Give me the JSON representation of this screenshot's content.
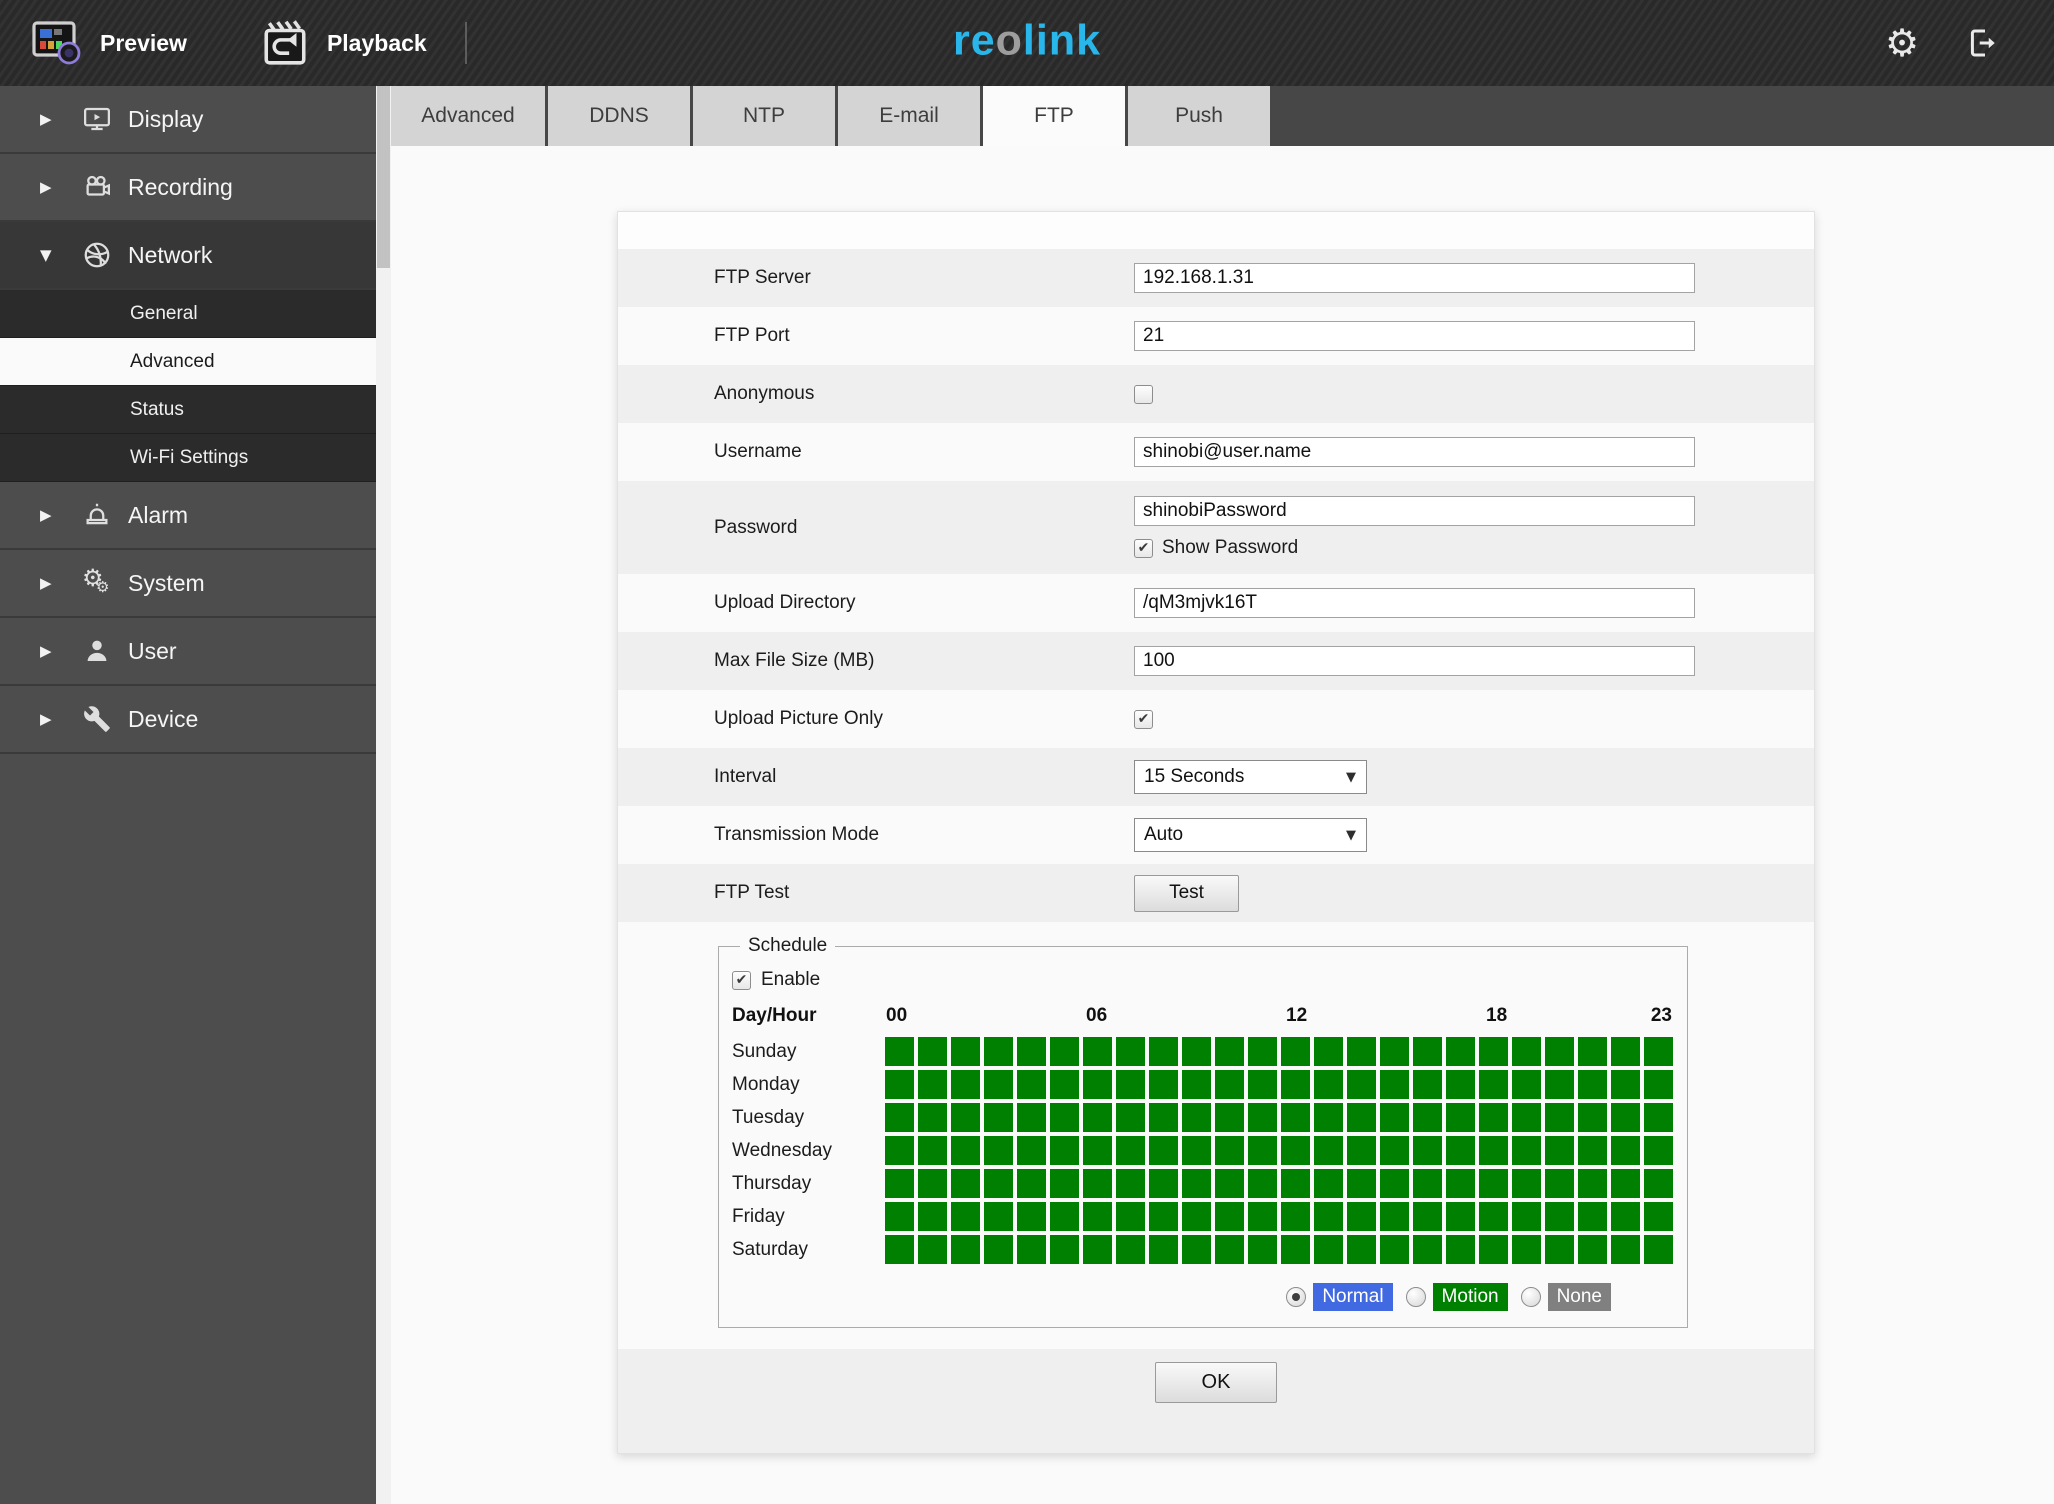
{
  "nav": {
    "preview_label": "Preview",
    "playback_label": "Playback",
    "logo": {
      "part1": "re",
      "part2": "o",
      "part3": "link",
      "accent_color": "#29b6ea",
      "muted_color": "#9d9d9d"
    }
  },
  "sidebar": {
    "items": [
      {
        "label": "Display",
        "icon": "monitor-icon",
        "expanded": false
      },
      {
        "label": "Recording",
        "icon": "video-camera-icon",
        "expanded": false
      },
      {
        "label": "Network",
        "icon": "globe-icon",
        "expanded": true,
        "children": [
          {
            "label": "General",
            "selected": false
          },
          {
            "label": "Advanced",
            "selected": true
          },
          {
            "label": "Status",
            "selected": false
          },
          {
            "label": "Wi-Fi Settings",
            "selected": false
          }
        ]
      },
      {
        "label": "Alarm",
        "icon": "siren-icon",
        "expanded": false
      },
      {
        "label": "System",
        "icon": "gears-icon",
        "expanded": false
      },
      {
        "label": "User",
        "icon": "user-icon",
        "expanded": false
      },
      {
        "label": "Device",
        "icon": "wrench-icon",
        "expanded": false
      }
    ]
  },
  "tabs": [
    {
      "label": "Advanced",
      "active": false
    },
    {
      "label": "DDNS",
      "active": false
    },
    {
      "label": "NTP",
      "active": false
    },
    {
      "label": "E-mail",
      "active": false
    },
    {
      "label": "FTP",
      "active": true
    },
    {
      "label": "Push",
      "active": false
    }
  ],
  "form": {
    "rows": [
      {
        "type": "text",
        "label": "FTP Server",
        "value": "192.168.1.31"
      },
      {
        "type": "text",
        "label": "FTP Port",
        "value": "21"
      },
      {
        "type": "checkbox",
        "label": "Anonymous",
        "checked": false
      },
      {
        "type": "text",
        "label": "Username",
        "value": "shinobi@user.name"
      },
      {
        "type": "password",
        "label": "Password",
        "value": "shinobiPassword",
        "sub_checkbox": {
          "label": "Show Password",
          "checked": true
        }
      },
      {
        "type": "text",
        "label": "Upload Directory",
        "value": "/qM3mjvk16T"
      },
      {
        "type": "text",
        "label": "Max File Size (MB)",
        "value": "100"
      },
      {
        "type": "checkbox",
        "label": "Upload Picture Only",
        "checked": true
      },
      {
        "type": "select",
        "label": "Interval",
        "value": "15 Seconds"
      },
      {
        "type": "select",
        "label": "Transmission Mode",
        "value": "Auto"
      },
      {
        "type": "button",
        "label": "FTP Test",
        "button_label": "Test"
      }
    ]
  },
  "schedule": {
    "legend": "Schedule",
    "enable": {
      "label": "Enable",
      "checked": true
    },
    "grid_corner_label": "Day/Hour",
    "hour_labels": [
      "00",
      "06",
      "12",
      "18",
      "23"
    ],
    "columns": 24,
    "days": [
      "Sunday",
      "Monday",
      "Tuesday",
      "Wednesday",
      "Thursday",
      "Friday",
      "Saturday"
    ],
    "all_cells_state": "filled",
    "cell_color": "#008000",
    "modes": [
      {
        "label": "Normal",
        "color": "#4169e1",
        "selected": true
      },
      {
        "label": "Motion",
        "color": "#008000",
        "selected": false
      },
      {
        "label": "None",
        "color": "#808080",
        "selected": false
      }
    ]
  },
  "footer": {
    "ok_label": "OK"
  }
}
